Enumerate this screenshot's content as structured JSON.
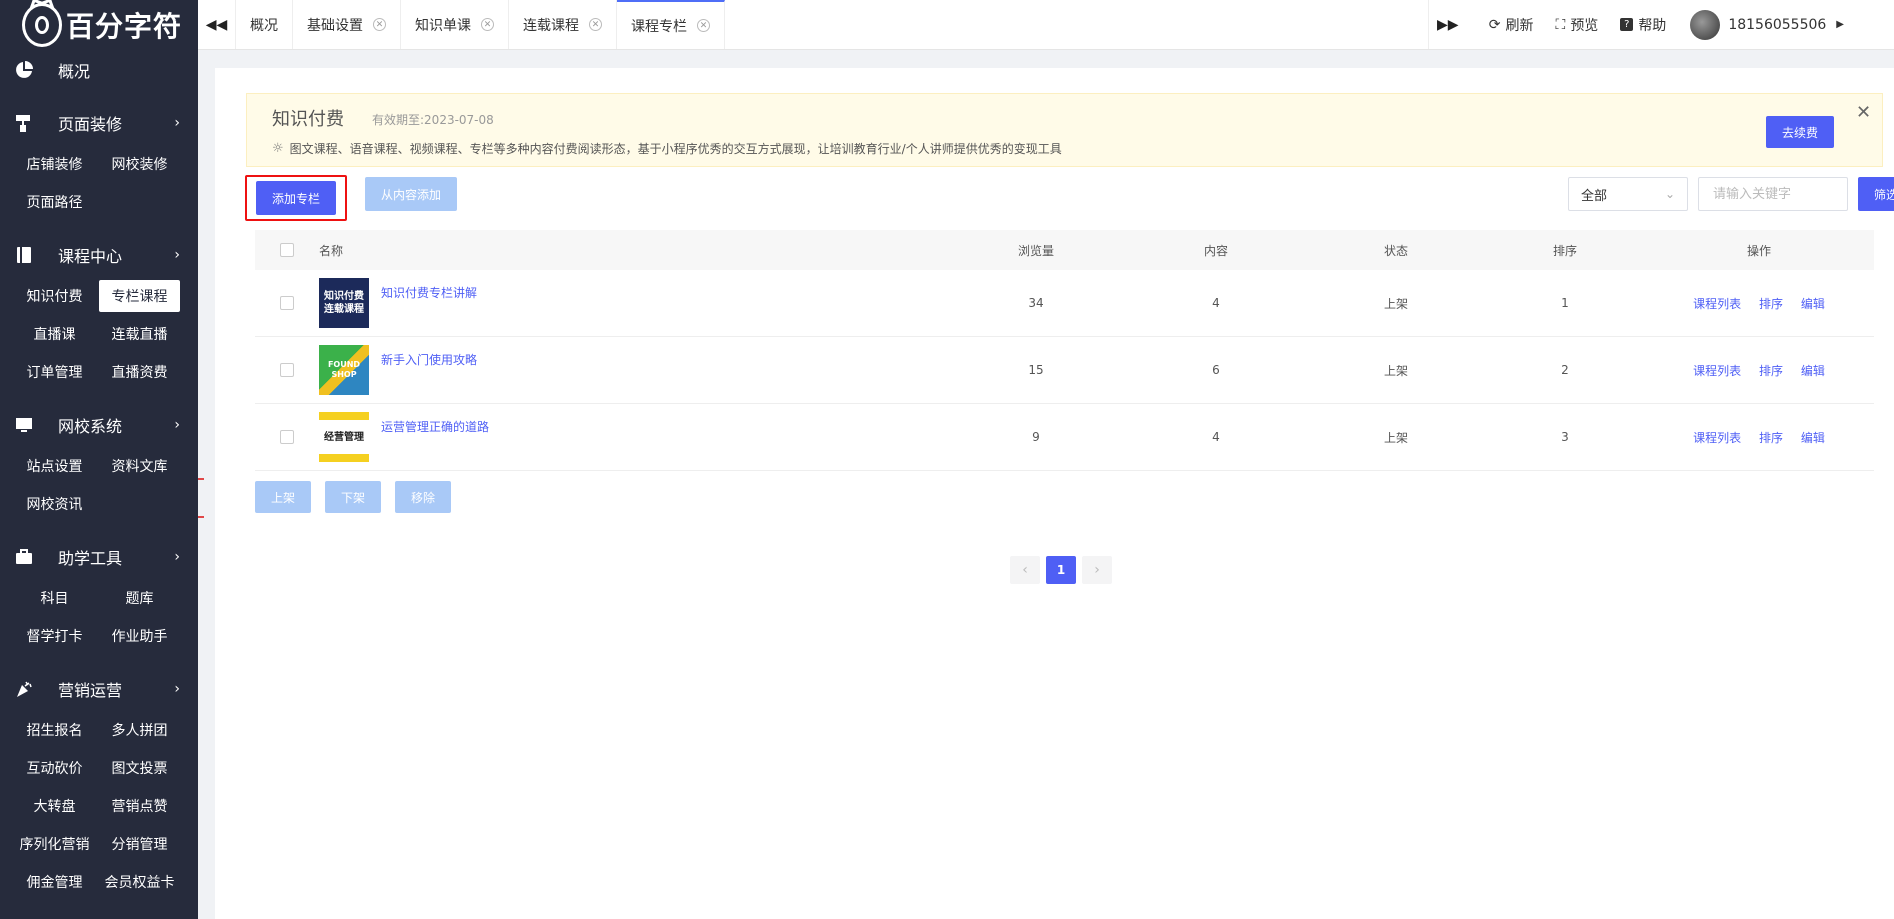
{
  "logo": {
    "text": "百分字符"
  },
  "sidebar": {
    "groups": [
      {
        "label": "概况",
        "icon": "pie-chart-icon",
        "chevron": false,
        "items": []
      },
      {
        "label": "页面装修",
        "icon": "paint-roller-icon",
        "chevron": true,
        "items": [
          "店铺装修",
          "网校装修",
          "页面路径"
        ]
      },
      {
        "label": "课程中心",
        "icon": "book-icon",
        "chevron": true,
        "items": [
          "知识付费",
          "专栏课程",
          "直播课",
          "连载直播",
          "订单管理",
          "直播资费"
        ],
        "active": "专栏课程"
      },
      {
        "label": "网校系统",
        "icon": "monitor-icon",
        "chevron": true,
        "items": [
          "站点设置",
          "资料文库",
          "网校资讯"
        ]
      },
      {
        "label": "助学工具",
        "icon": "briefcase-icon",
        "chevron": true,
        "items": [
          "科目",
          "题库",
          "督学打卡",
          "作业助手"
        ]
      },
      {
        "label": "营销运营",
        "icon": "party-popper-icon",
        "chevron": true,
        "items": [
          "招生报名",
          "多人拼团",
          "互动砍价",
          "图文投票",
          "大转盘",
          "营销点赞",
          "序列化营销",
          "分销管理",
          "佣金管理",
          "会员权益卡"
        ]
      }
    ]
  },
  "topbar": {
    "tabs": [
      {
        "label": "概况",
        "closable": false,
        "active": false
      },
      {
        "label": "基础设置",
        "closable": true,
        "active": false
      },
      {
        "label": "知识单课",
        "closable": true,
        "active": false
      },
      {
        "label": "连载课程",
        "closable": true,
        "active": false
      },
      {
        "label": "课程专栏",
        "closable": true,
        "active": true
      }
    ],
    "actions": [
      {
        "label": "刷新",
        "icon": "refresh-icon"
      },
      {
        "label": "预览",
        "icon": "preview-icon"
      },
      {
        "label": "帮助",
        "icon": "help-icon"
      }
    ],
    "user": {
      "name": "18156055506"
    }
  },
  "banner": {
    "title": "知识付费",
    "expiry": "有效期至:2023-07-08",
    "description": "图文课程、语音课程、视频课程、专栏等多种内容付费阅读形态，基于小程序优秀的交互方式展现，让培训教育行业/个人讲师提供优秀的变现工具",
    "renew_label": "去续费"
  },
  "toolbar": {
    "add_label": "添加专栏",
    "import_label": "从内容添加",
    "select_value": "全部",
    "search_placeholder": "请输入关键字",
    "filter_label": "筛选"
  },
  "table": {
    "headers": {
      "name": "名称",
      "views": "浏览量",
      "content": "内容",
      "status": "状态",
      "sort": "排序",
      "ops": "操作"
    },
    "rows": [
      {
        "thumb_text": "知识付费 连载课程",
        "name": "知识付费专栏讲解",
        "views": "34",
        "content": "4",
        "status": "上架",
        "sort": "1"
      },
      {
        "thumb_text": "FOUND SHOP",
        "name": "新手入门使用攻略",
        "views": "15",
        "content": "6",
        "status": "上架",
        "sort": "2"
      },
      {
        "thumb_text": "经营管理",
        "name": "运营管理正确的道路",
        "views": "9",
        "content": "4",
        "status": "上架",
        "sort": "3"
      }
    ],
    "ops": [
      "课程列表",
      "排序",
      "编辑"
    ]
  },
  "bulk": {
    "on_label": "上架",
    "off_label": "下架",
    "remove_label": "移除"
  },
  "pager": {
    "current": "1"
  }
}
